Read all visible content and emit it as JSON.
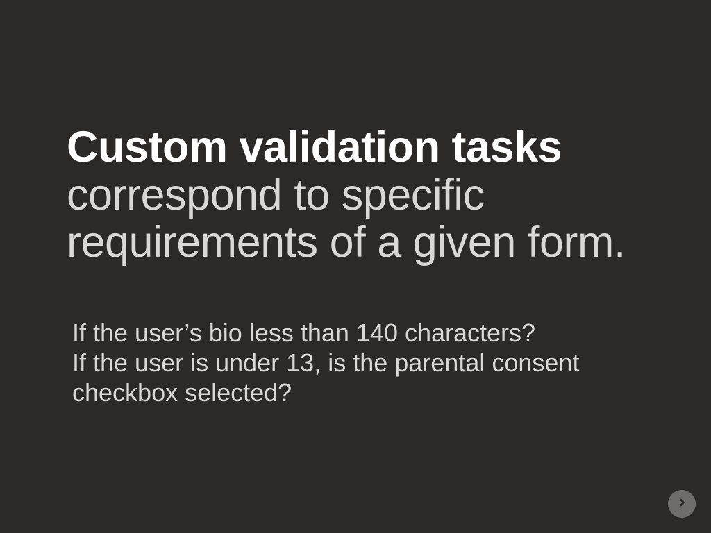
{
  "slide": {
    "heading_bold": "Custom validation tasks",
    "heading_rest": " correspond to specific requirements of a given form.",
    "body_line1": "If the user’s bio less than 140 characters?",
    "body_line2": "If the user is under 13, is the parental consent checkbox selected?"
  },
  "nav": {
    "next_icon": "arrow-right"
  }
}
